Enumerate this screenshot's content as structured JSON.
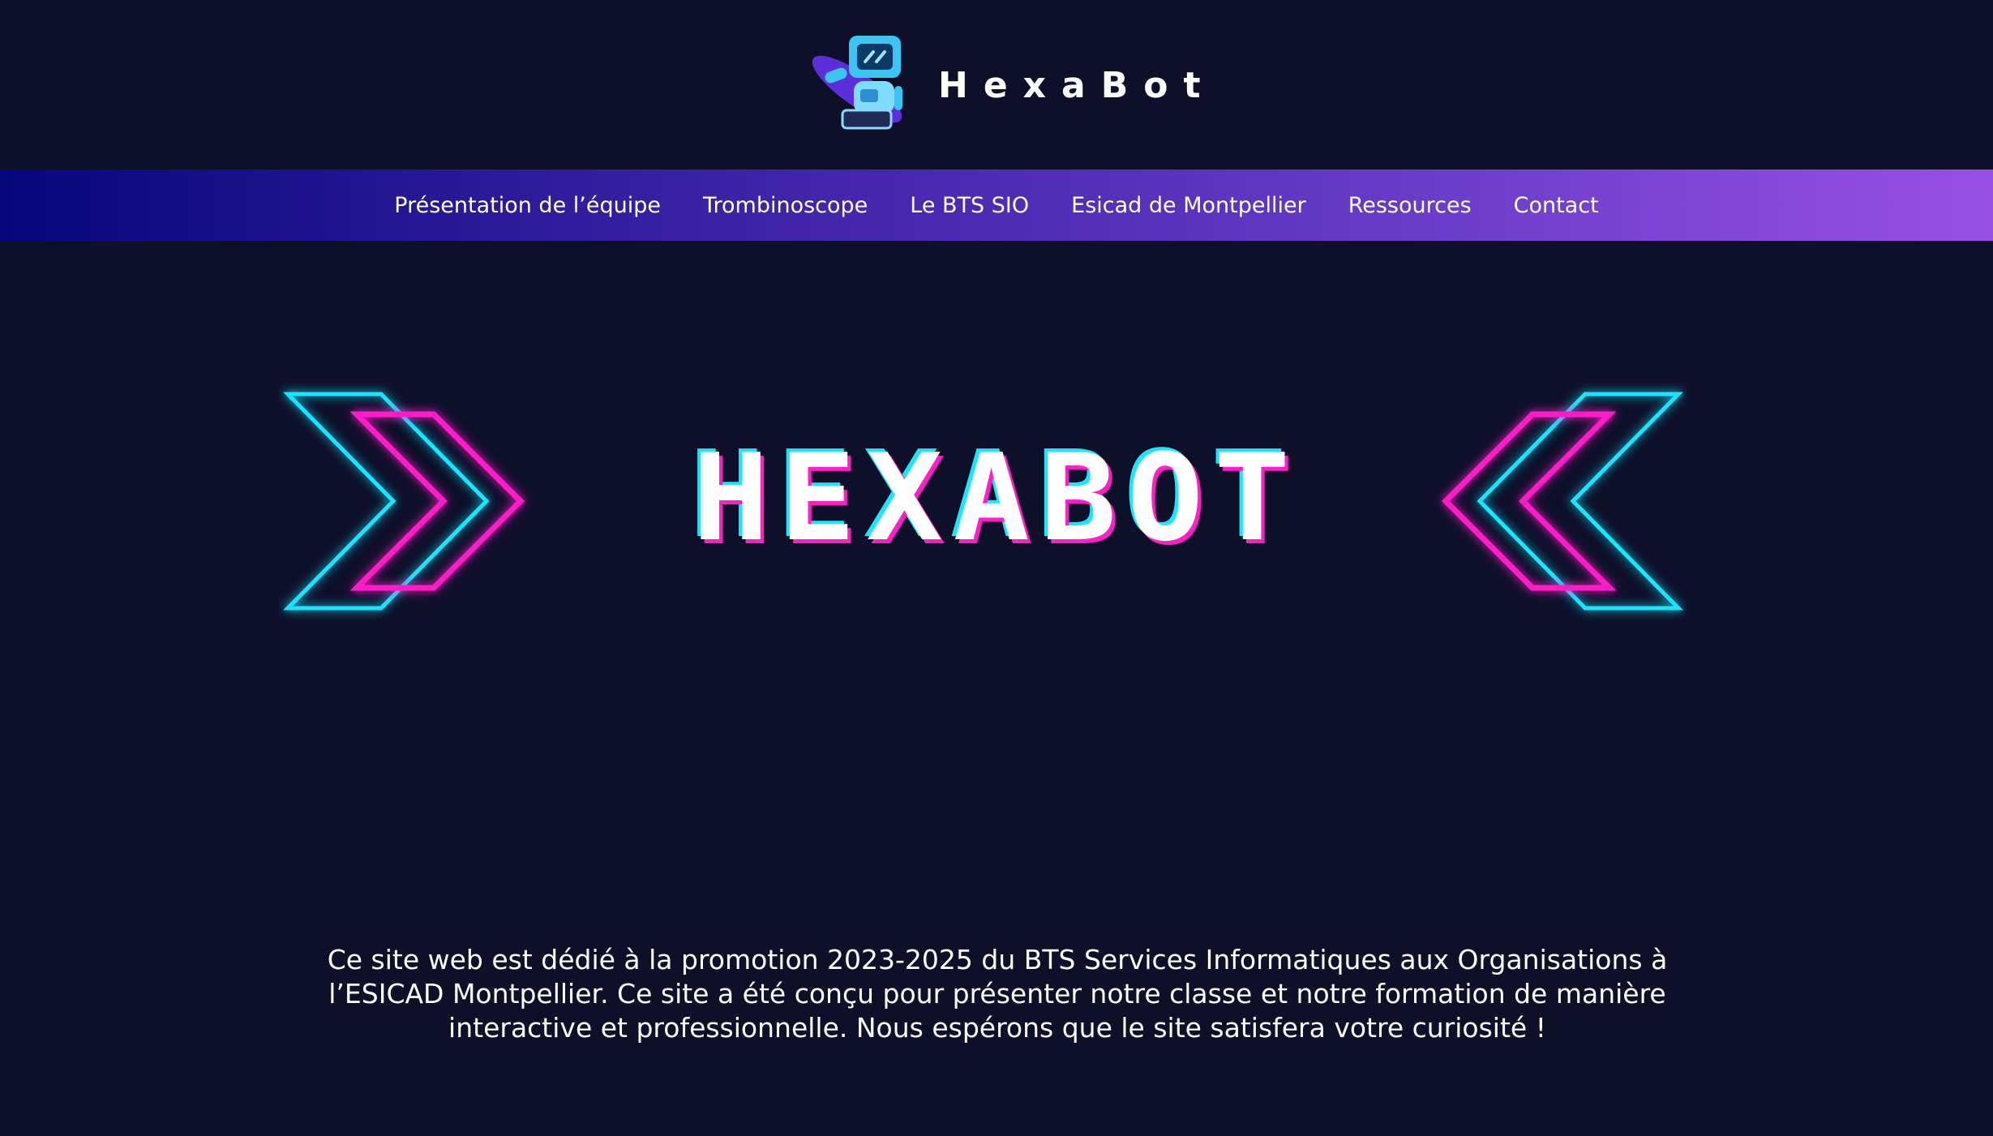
{
  "header": {
    "brand_name": "HexaBot",
    "logo_icon": "robot-mascot-icon"
  },
  "nav": {
    "items": [
      {
        "label": "Présentation de l’équipe"
      },
      {
        "label": "Trombinoscope"
      },
      {
        "label": "Le BTS SIO"
      },
      {
        "label": "Esicad de Montpellier"
      },
      {
        "label": "Ressources"
      },
      {
        "label": "Contact"
      }
    ],
    "gradient_start": "#06077a",
    "gradient_end": "#9850e4"
  },
  "hero": {
    "title": "HEXABOT",
    "left_icon": "neon-chevron-right-icon",
    "right_icon": "neon-chevron-left-icon",
    "neon_cyan": "#18e6ff",
    "neon_magenta": "#ff1ec8"
  },
  "intro": {
    "text": "Ce site web est dédié à la promotion 2023-2025 du BTS Services Informatiques aux Organisations à l’ESICAD Montpellier. Ce site a été conçu pour présenter notre classe et notre formation de manière interactive et professionnelle. Nous espérons que le site satisfera votre curiosité !"
  },
  "colors": {
    "background": "#0e102a",
    "text": "#ffffff"
  }
}
